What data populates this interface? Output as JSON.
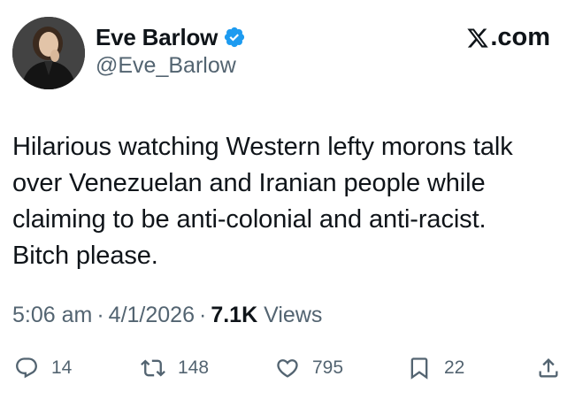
{
  "author": {
    "name": "Eve Barlow",
    "handle": "@Eve_Barlow",
    "verified": true
  },
  "brand": {
    "label": ".com",
    "icon": "x-logo-icon"
  },
  "tweet": {
    "lines": [
      "Hilarious watching Western lefty morons talk",
      "over Venezuelan and Iranian people while",
      "claiming to be anti-colonial and anti-racist.",
      "Bitch please."
    ]
  },
  "meta": {
    "time": "5:06 am",
    "separator": "·",
    "date": "4/1/2026",
    "views_count": "7.1K",
    "views_label": "Views"
  },
  "actions": {
    "reply": {
      "icon": "reply-icon",
      "count": "14"
    },
    "retweet": {
      "icon": "retweet-icon",
      "count": "148"
    },
    "like": {
      "icon": "heart-icon",
      "count": "795"
    },
    "bookmark": {
      "icon": "bookmark-icon",
      "count": "22"
    },
    "share": {
      "icon": "share-icon"
    }
  },
  "colors": {
    "text_primary": "#0f1419",
    "text_secondary": "#536471",
    "verified_blue": "#1d9bf0"
  }
}
